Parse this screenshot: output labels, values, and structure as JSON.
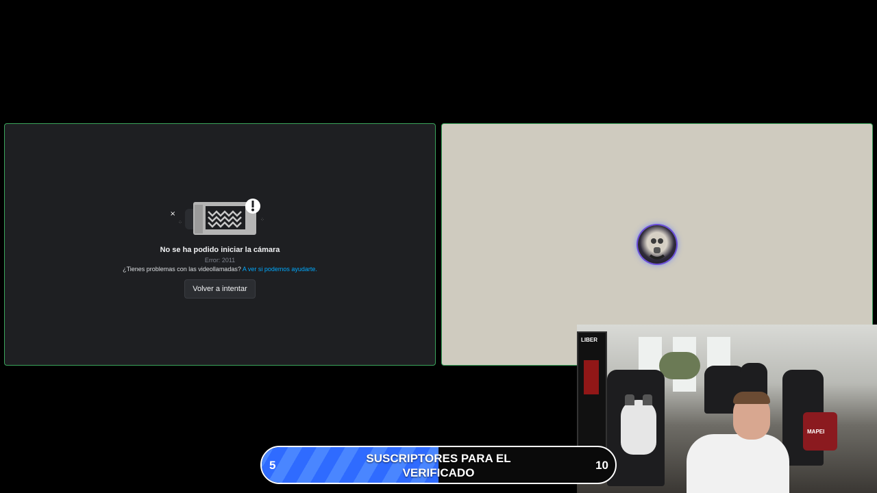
{
  "left_tile": {
    "error_title": "No se ha podido iniciar la cámara",
    "error_code": "Error: 2011",
    "help_text": "¿Tienes problemas con las videollamadas?",
    "help_link": "A ver si podemos ayudarte.",
    "retry_label": "Volver a intentar"
  },
  "webcam": {
    "fridge_label": "LIBER",
    "jersey_text": "MAPEI"
  },
  "progress": {
    "current": "5",
    "goal": "10",
    "fill_fraction": 0.5,
    "label": "SUSCRIPTORES PARA EL VERIFICADO"
  }
}
